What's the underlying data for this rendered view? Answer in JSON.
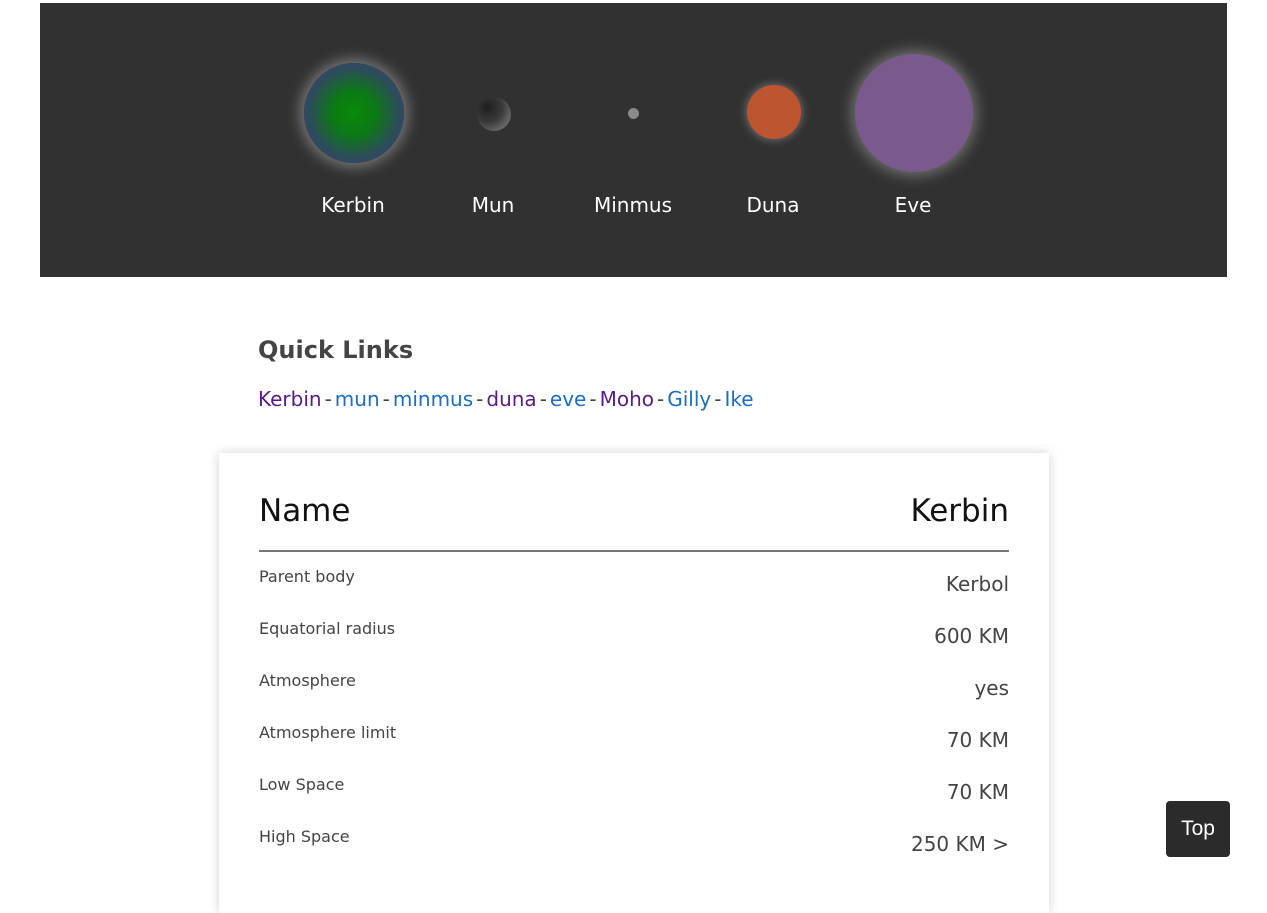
{
  "planets": [
    {
      "name": "Kerbin"
    },
    {
      "name": "Mun"
    },
    {
      "name": "Minmus"
    },
    {
      "name": "Duna"
    },
    {
      "name": "Eve"
    }
  ],
  "quick_links": {
    "title": "Quick Links",
    "separator": "-",
    "items": [
      {
        "label": "Kerbin",
        "color": "#5b1a8a"
      },
      {
        "label": "mun",
        "color": "#1a6fc4"
      },
      {
        "label": "minmus",
        "color": "#1a6fc4"
      },
      {
        "label": "duna",
        "color": "#5b1a8a"
      },
      {
        "label": "eve",
        "color": "#1a6fc4"
      },
      {
        "label": "Moho",
        "color": "#5b1a8a"
      },
      {
        "label": "Gilly",
        "color": "#1a6fc4"
      },
      {
        "label": "Ike",
        "color": "#1a6fc4"
      }
    ]
  },
  "table": {
    "header_key": "Name",
    "header_value": "Kerbin",
    "rows": [
      {
        "key": "Parent body",
        "value": "Kerbol"
      },
      {
        "key": "Equatorial radius",
        "value": "600 KM"
      },
      {
        "key": "Atmosphere",
        "value": "yes"
      },
      {
        "key": "Atmosphere limit",
        "value": "70 KM"
      },
      {
        "key": "Low Space",
        "value": "70 KM"
      },
      {
        "key": "High Space",
        "value": "250 KM >"
      }
    ]
  },
  "top_button": {
    "label": "Top"
  }
}
